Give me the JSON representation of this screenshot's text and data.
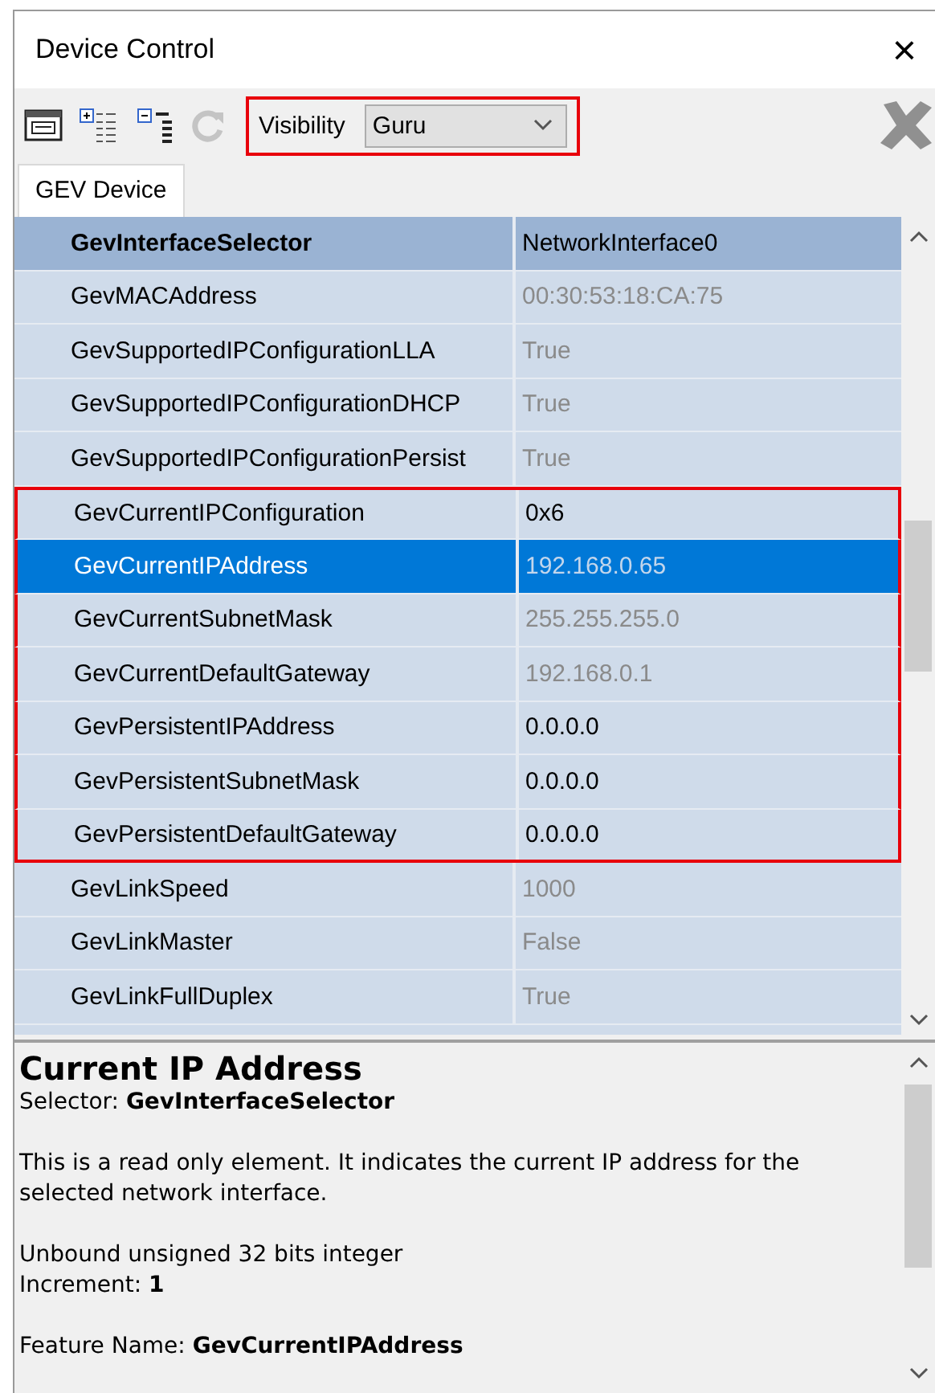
{
  "window": {
    "title": "Device Control",
    "close": "×"
  },
  "toolbar": {
    "visibility": {
      "label": "Visibility",
      "value": "Guru",
      "outlined": true
    },
    "refresh_disabled": true
  },
  "tabs": [
    {
      "label": "GEV Device",
      "selected": true
    }
  ],
  "rows": [
    {
      "kind": "selector",
      "name": "GevInterfaceSelector",
      "value": "NetworkInterface0",
      "read_only": false,
      "selected": false,
      "outlined": false
    },
    {
      "kind": "feature",
      "name": "GevMACAddress",
      "value": "00:30:53:18:CA:75",
      "read_only": true,
      "selected": false,
      "outlined": false
    },
    {
      "kind": "feature",
      "name": "GevSupportedIPConfigurationLLA",
      "value": "True",
      "read_only": true,
      "selected": false,
      "outlined": false
    },
    {
      "kind": "feature",
      "name": "GevSupportedIPConfigurationDHCP",
      "value": "True",
      "read_only": true,
      "selected": false,
      "outlined": false
    },
    {
      "kind": "feature",
      "name": "GevSupportedIPConfigurationPersist",
      "value": "True",
      "read_only": true,
      "selected": false,
      "outlined": false
    },
    {
      "kind": "feature",
      "name": "GevCurrentIPConfiguration",
      "value": "0x6",
      "read_only": false,
      "selected": false,
      "outlined": true
    },
    {
      "kind": "feature",
      "name": "GevCurrentIPAddress",
      "value": "192.168.0.65",
      "read_only": true,
      "selected": true,
      "outlined": true
    },
    {
      "kind": "feature",
      "name": "GevCurrentSubnetMask",
      "value": "255.255.255.0",
      "read_only": true,
      "selected": false,
      "outlined": true
    },
    {
      "kind": "feature",
      "name": "GevCurrentDefaultGateway",
      "value": "192.168.0.1",
      "read_only": true,
      "selected": false,
      "outlined": true
    },
    {
      "kind": "feature",
      "name": "GevPersistentIPAddress",
      "value": "0.0.0.0",
      "read_only": false,
      "selected": false,
      "outlined": true
    },
    {
      "kind": "feature",
      "name": "GevPersistentSubnetMask",
      "value": "0.0.0.0",
      "read_only": false,
      "selected": false,
      "outlined": true
    },
    {
      "kind": "feature",
      "name": "GevPersistentDefaultGateway",
      "value": "0.0.0.0",
      "read_only": false,
      "selected": false,
      "outlined": true
    },
    {
      "kind": "feature",
      "name": "GevLinkSpeed",
      "value": "1000",
      "read_only": true,
      "selected": false,
      "outlined": false
    },
    {
      "kind": "feature",
      "name": "GevLinkMaster",
      "value": "False",
      "read_only": true,
      "selected": false,
      "outlined": false
    },
    {
      "kind": "feature",
      "name": "GevLinkFullDuplex",
      "value": "True",
      "read_only": true,
      "selected": false,
      "outlined": false
    }
  ],
  "description": {
    "title": "Current IP Address",
    "paragraphs": [
      [
        "Selector: **GevInterfaceSelector**"
      ],
      [
        "This is a read only element. It indicates the current IP address for the selected network interface."
      ],
      [
        "Unbound unsigned 32 bits integer",
        "Increment: **1**"
      ],
      [
        "Feature Name: **GevCurrentIPAddress**"
      ]
    ]
  }
}
